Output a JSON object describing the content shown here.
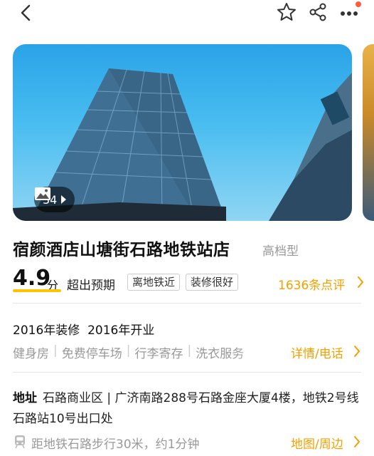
{
  "nav": {
    "icons": [
      "back-icon",
      "star-icon",
      "share-icon",
      "more-icon"
    ],
    "badge_color": "#ff5b3a"
  },
  "gallery": {
    "photo_count": "34"
  },
  "hotel": {
    "name": "宿颜酒店山塘街石路地铁站店",
    "grade": "高档型"
  },
  "rating": {
    "score": "4.9",
    "unit": "分",
    "label": "超出预期",
    "tags": [
      "离地铁近",
      "装修很好"
    ],
    "reviews": "1636条点评"
  },
  "info": {
    "renovated": "2016年装修",
    "opened": "2016年开业",
    "facilities": [
      "健身房",
      "免费停车场",
      "行李寄存",
      "洗衣服务"
    ],
    "detail_link": "详情/电话"
  },
  "location": {
    "label": "地址",
    "address": "石路商业区 | 广济南路288号石路金座大厦4楼，地铁2号线石路站10号出口处",
    "metro": "距地铁石路步行30米，约1分钟",
    "map_link": "地图/周边"
  },
  "colors": {
    "accent": "#f5a000",
    "score_underline": "#ffc300"
  }
}
